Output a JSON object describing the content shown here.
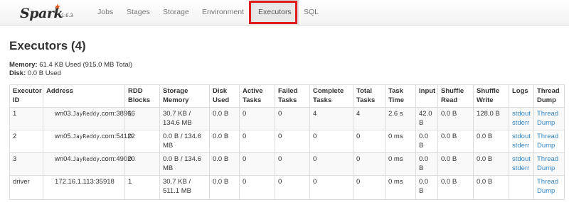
{
  "brand": {
    "logo_text": "Spark",
    "version": "1.6.3"
  },
  "nav": {
    "items": [
      {
        "label": "Jobs"
      },
      {
        "label": "Stages"
      },
      {
        "label": "Storage"
      },
      {
        "label": "Environment"
      },
      {
        "label": "Executors"
      },
      {
        "label": "SQL"
      }
    ],
    "active": "Executors"
  },
  "annotation": {
    "highlight_color": "#e01d1d",
    "highlight_target": "Executors"
  },
  "page": {
    "title": "Executors (4)",
    "memory_label": "Memory:",
    "memory_value": " 61.4 KB Used (915.0 MB Total)",
    "disk_label": "Disk:",
    "disk_value": " 0.0 B Used"
  },
  "table": {
    "headers": [
      "Executor ID",
      "Address",
      "RDD Blocks",
      "Storage Memory",
      "Disk Used",
      "Active Tasks",
      "Failed Tasks",
      "Complete Tasks",
      "Total Tasks",
      "Task Time",
      "Input",
      "Shuffle Read",
      "Shuffle Write",
      "Logs",
      "Thread Dump"
    ],
    "rows": [
      {
        "id": "1",
        "address_prefix": "wn03.",
        "address_stamp": "JayReddy",
        "address_suffix": ".com:38966",
        "rdd_blocks": "1",
        "storage_memory": "30.7 KB / 134.6 MB",
        "disk_used": "0.0 B",
        "active_tasks": "0",
        "failed_tasks": "0",
        "complete_tasks": "4",
        "total_tasks": "4",
        "task_time": "2.6 s",
        "input": "42.0 B",
        "shuffle_read": "0.0 B",
        "shuffle_write": "128.0 B",
        "log_stdout": "stdout",
        "log_stderr": "stderr",
        "thread_dump": "Thread Dump"
      },
      {
        "id": "2",
        "address_prefix": "wn05.",
        "address_stamp": "JayReddy",
        "address_suffix": ".com:54122",
        "rdd_blocks": "0",
        "storage_memory": "0.0 B / 134.6 MB",
        "disk_used": "0.0 B",
        "active_tasks": "0",
        "failed_tasks": "0",
        "complete_tasks": "0",
        "total_tasks": "0",
        "task_time": "0 ms",
        "input": "0.0 B",
        "shuffle_read": "0.0 B",
        "shuffle_write": "0.0 B",
        "log_stdout": "stdout",
        "log_stderr": "stderr",
        "thread_dump": "Thread Dump"
      },
      {
        "id": "3",
        "address_prefix": "wn04.",
        "address_stamp": "JayReddy",
        "address_suffix": ".com:49020",
        "rdd_blocks": "0",
        "storage_memory": "0.0 B / 134.6 MB",
        "disk_used": "0.0 B",
        "active_tasks": "0",
        "failed_tasks": "0",
        "complete_tasks": "0",
        "total_tasks": "0",
        "task_time": "0 ms",
        "input": "0.0 B",
        "shuffle_read": "0.0 B",
        "shuffle_write": "0.0 B",
        "log_stdout": "stdout",
        "log_stderr": "stderr",
        "thread_dump": "Thread Dump"
      },
      {
        "id": "driver",
        "address": "172.16.1.113:35918",
        "rdd_blocks": "1",
        "storage_memory": "30.7 KB / 511.1 MB",
        "disk_used": "0.0 B",
        "active_tasks": "0",
        "failed_tasks": "0",
        "complete_tasks": "0",
        "total_tasks": "0",
        "task_time": "0 ms",
        "input": "0.0 B",
        "shuffle_read": "0.0 B",
        "shuffle_write": "0.0 B",
        "thread_dump": "Thread Dump"
      }
    ]
  },
  "colors": {
    "link": "#3487c7",
    "brand_accent": "#e25a1c"
  },
  "icons": {
    "brand_star": "spark-star-icon"
  }
}
